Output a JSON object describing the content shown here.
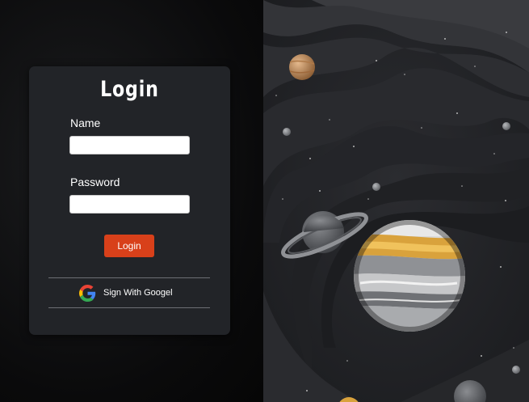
{
  "login": {
    "title": "Login",
    "name_label": "Name",
    "name_value": "",
    "password_label": "Password",
    "password_value": "",
    "submit_label": "Login",
    "google_label": "Sign With Googel"
  },
  "colors": {
    "card_background": "#222428",
    "accent": "#d8401a",
    "page_background": "#0b0b0c"
  },
  "icons": {
    "google": "google-g-icon"
  }
}
